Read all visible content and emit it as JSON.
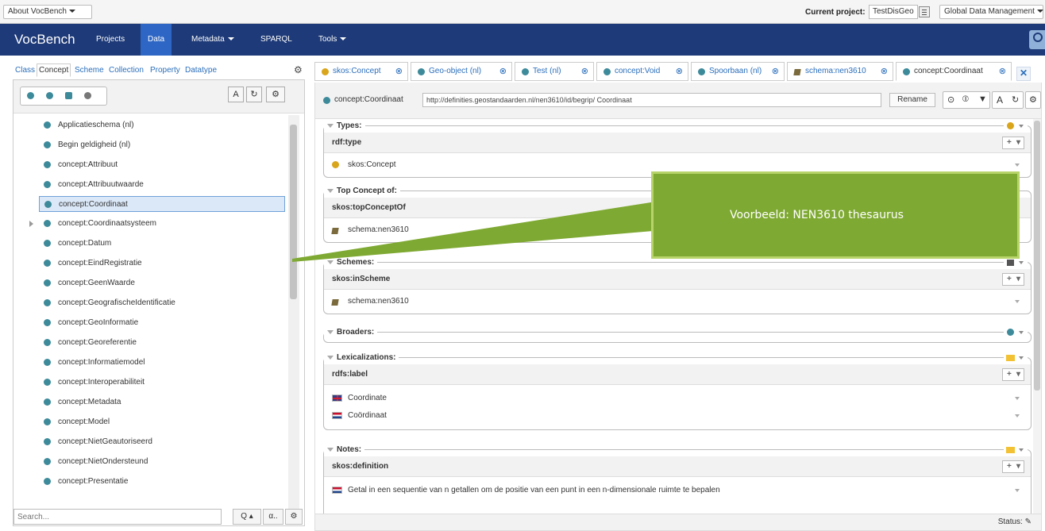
{
  "topbar": {
    "about": "About VocBench",
    "current_project_label": "Current project:",
    "current_project_value": "TestDisGeo",
    "global_menu": "Global Data Management"
  },
  "navbar": {
    "brand": "VocBench",
    "items": [
      "Projects",
      "Data",
      "Metadata",
      "SPARQL",
      "Tools"
    ],
    "active": "Data"
  },
  "left_panel": {
    "tabs": [
      "Class",
      "Concept",
      "Scheme",
      "Collection",
      "Property",
      "Datatype"
    ],
    "active_tab": "Concept",
    "concepts": [
      "Applicatieschema (nl)",
      "Begin geldigheid (nl)",
      "concept:Attribuut",
      "concept:Attribuutwaarde",
      "concept:Coordinaat",
      "concept:Coordinaatsysteem",
      "concept:Datum",
      "concept:EindRegistratie",
      "concept:GeenWaarde",
      "concept:GeografischeIdentificatie",
      "concept:GeoInformatie",
      "concept:Georeferentie",
      "concept:Informatiemodel",
      "concept:Interoperabiliteit",
      "concept:Metadata",
      "concept:Model",
      "concept:NietGeautoriseerd",
      "concept:NietOndersteund",
      "concept:Presentatie"
    ],
    "selected": "concept:Coordinaat",
    "search_placeholder": "Search...",
    "alpha_btn": "α.."
  },
  "right_tabs": [
    "skos:Concept",
    "Geo-object (nl)",
    "Test (nl)",
    "concept:Void",
    "Spoorbaan (nl)",
    "schema:nen3610",
    "concept:Coordinaat"
  ],
  "resource": {
    "name": "concept:Coordinaat",
    "uri": "http://definities.geostandaarden.nl/nen3610/id/begrip/ Coordinaat",
    "rename": "Rename"
  },
  "sections": {
    "types": {
      "title": "Types:",
      "prop": "rdf:type",
      "values": [
        "skos:Concept"
      ]
    },
    "top_concept": {
      "title": "Top Concept of:",
      "prop": "skos:topConceptOf",
      "values": [
        "schema:nen3610"
      ]
    },
    "schemes": {
      "title": "Schemes:",
      "prop": "skos:inScheme",
      "values": [
        "schema:nen3610"
      ]
    },
    "broaders": {
      "title": "Broaders:"
    },
    "lexicalizations": {
      "title": "Lexicalizations:",
      "prop": "rdfs:label",
      "values": [
        "Coordinate",
        "Coördinaat"
      ]
    },
    "notes": {
      "title": "Notes:",
      "prop": "skos:definition",
      "values": [
        "Getal in een sequentie van n getallen om de positie van een punt in een n-dimensionale ruimte te bepalen"
      ]
    }
  },
  "status": "Status:",
  "callout": {
    "text": "Voorbeeld: NEN3610 thesaurus",
    "color": "#7ea932"
  }
}
